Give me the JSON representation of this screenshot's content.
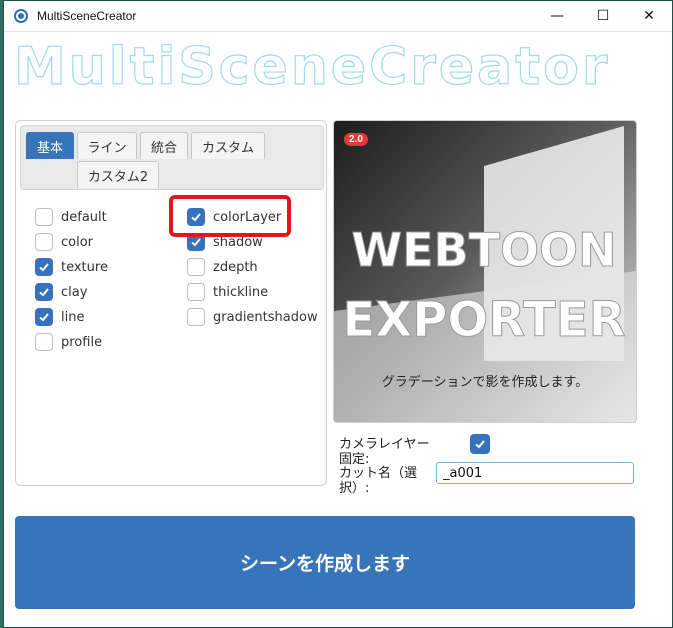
{
  "window": {
    "title": "MultiSceneCreator",
    "controls": {
      "minimize": "—",
      "maximize": "☐",
      "close": "✕"
    }
  },
  "banner": {
    "text": "MultiSceneCreator"
  },
  "tabs": [
    {
      "label": "基本",
      "active": true
    },
    {
      "label": "ライン",
      "active": false
    },
    {
      "label": "統合",
      "active": false
    },
    {
      "label": "カスタム",
      "active": false
    },
    {
      "label": "カスタム2",
      "active": false
    }
  ],
  "options_left": [
    {
      "label": "default",
      "checked": false
    },
    {
      "label": "color",
      "checked": false
    },
    {
      "label": "texture",
      "checked": true
    },
    {
      "label": "clay",
      "checked": true
    },
    {
      "label": "line",
      "checked": true
    },
    {
      "label": "profile",
      "checked": false
    }
  ],
  "options_right": [
    {
      "label": "colorLayer",
      "checked": true
    },
    {
      "label": "shadow",
      "checked": true
    },
    {
      "label": "zdepth",
      "checked": false
    },
    {
      "label": "thickline",
      "checked": false
    },
    {
      "label": "gradientshadow",
      "checked": false
    }
  ],
  "preview": {
    "badge": "2.0",
    "logo_line1": "WEBTOON",
    "logo_line2": "EXPORTER",
    "caption": "グラデーションで影を作成します。"
  },
  "form": {
    "camera_label": "カメラレイヤー固定:",
    "camera_checked": true,
    "cut_label": "カット名（選択）:",
    "cut_value": "_a001"
  },
  "action": {
    "label": "シーンを作成します"
  },
  "colors": {
    "accent": "#3774ba",
    "highlight": "#e0171f"
  }
}
